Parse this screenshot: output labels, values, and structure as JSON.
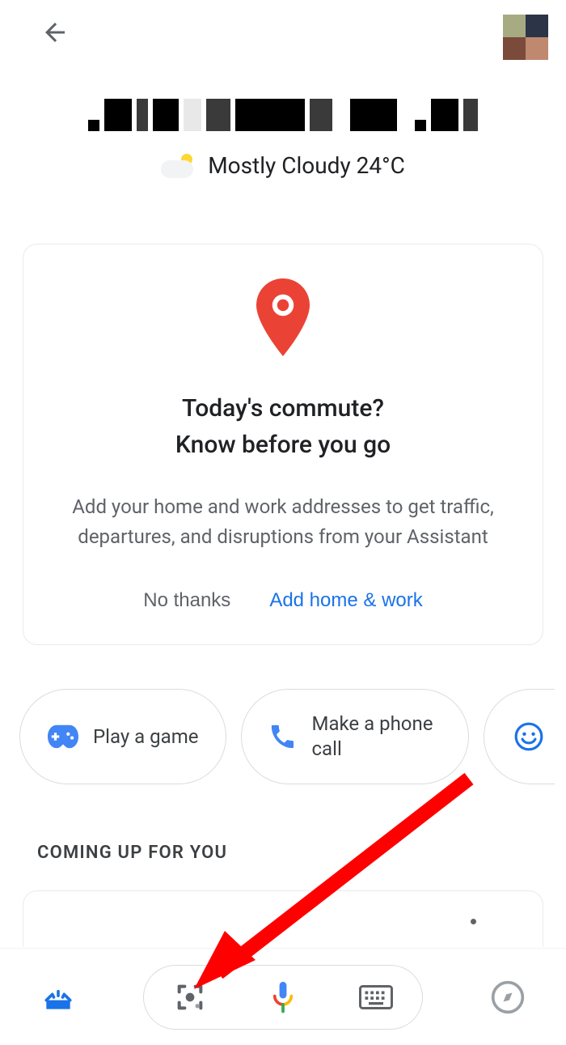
{
  "weather": {
    "text": "Mostly Cloudy 24°C"
  },
  "card": {
    "title_line1": "Today's commute?",
    "title_line2": "Know before you go",
    "subtitle": "Add your home and work addresses to get traffic, departures, and disruptions from your Assistant",
    "decline_label": "No thanks",
    "accept_label": "Add home & work"
  },
  "chips": {
    "play_game": "Play a game",
    "phone_call": "Make a phone call"
  },
  "section": {
    "coming_up": "COMING UP FOR YOU"
  }
}
